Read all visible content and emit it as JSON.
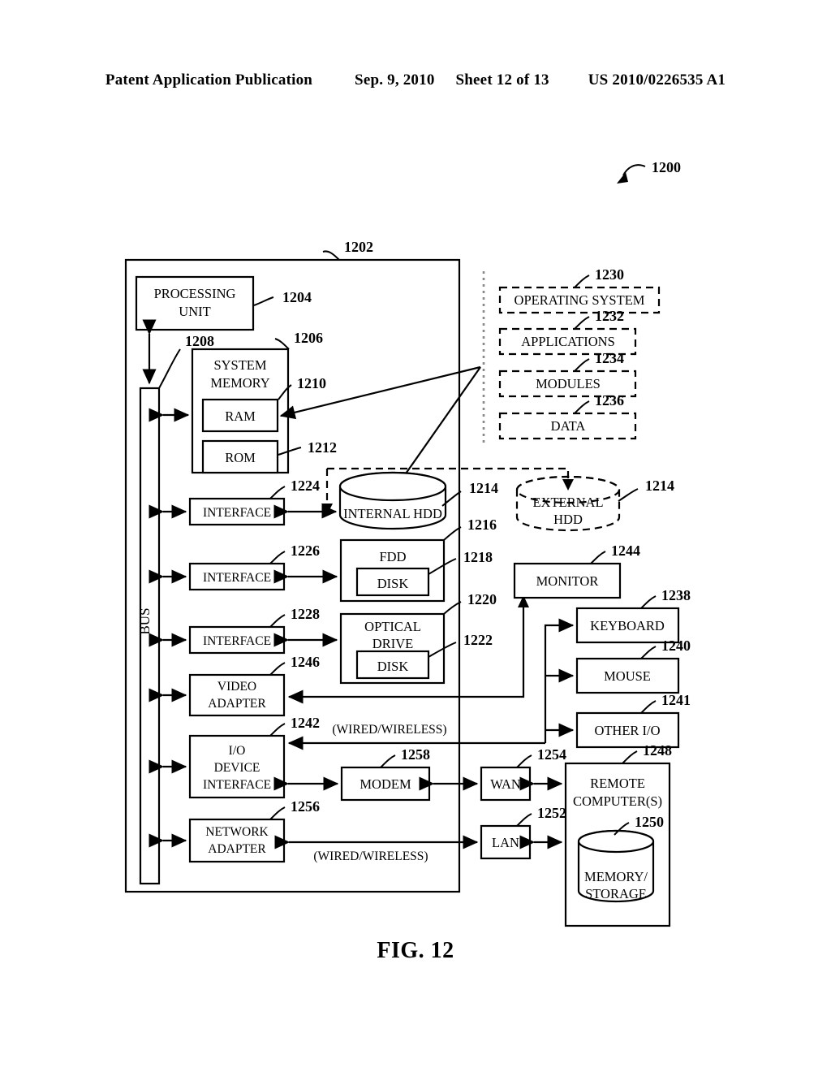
{
  "header": {
    "publication": "Patent Application Publication",
    "date": "Sep. 9, 2010",
    "sheet": "Sheet 12 of 13",
    "patent_number": "US 2010/0226535 A1"
  },
  "figure": {
    "caption": "FIG. 12",
    "system_ref": "1200"
  },
  "blocks": {
    "computer_boundary": {
      "ref": "1202"
    },
    "processing_unit": {
      "label_line1": "PROCESSING",
      "label_line2": "UNIT",
      "ref": "1204"
    },
    "system_memory": {
      "label_line1": "SYSTEM",
      "label_line2": "MEMORY",
      "ref": "1206"
    },
    "bus": {
      "label": "BUS",
      "ref": "1208"
    },
    "ram": {
      "label": "RAM",
      "ref": "1210"
    },
    "rom": {
      "label": "ROM",
      "ref": "1212"
    },
    "internal_hdd": {
      "label": "INTERNAL HDD",
      "ref": "1214"
    },
    "external_hdd": {
      "label_line1": "EXTERNAL",
      "label_line2": "HDD",
      "ref": "1214"
    },
    "fdd": {
      "label": "FDD",
      "ref": "1216"
    },
    "fdd_disk": {
      "label": "DISK",
      "ref": "1218"
    },
    "optical_drive": {
      "label_line1": "OPTICAL",
      "label_line2": "DRIVE",
      "ref": "1220"
    },
    "optical_disk": {
      "label": "DISK",
      "ref": "1222"
    },
    "interface_hdd": {
      "label": "INTERFACE",
      "ref": "1224"
    },
    "interface_fdd": {
      "label": "INTERFACE",
      "ref": "1226"
    },
    "interface_optical": {
      "label": "INTERFACE",
      "ref": "1228"
    },
    "operating_system": {
      "label": "OPERATING SYSTEM",
      "ref": "1230"
    },
    "applications": {
      "label": "APPLICATIONS",
      "ref": "1232"
    },
    "modules": {
      "label": "MODULES",
      "ref": "1234"
    },
    "data_store": {
      "label": "DATA",
      "ref": "1236"
    },
    "keyboard": {
      "label": "KEYBOARD",
      "ref": "1238"
    },
    "mouse": {
      "label": "MOUSE",
      "ref": "1240"
    },
    "other_io": {
      "label": "OTHER I/O",
      "ref": "1241"
    },
    "io_device_interface": {
      "label_line1": "I/O",
      "label_line2": "DEVICE",
      "label_line3": "INTERFACE",
      "ref": "1242"
    },
    "monitor": {
      "label": "MONITOR",
      "ref": "1244"
    },
    "video_adapter": {
      "label_line1": "VIDEO",
      "label_line2": "ADAPTER",
      "ref": "1246"
    },
    "remote_computers": {
      "label_line1": "REMOTE",
      "label_line2": "COMPUTER(S)",
      "ref": "1248"
    },
    "memory_storage": {
      "label_line1": "MEMORY/",
      "label_line2": "STORAGE",
      "ref": "1250"
    },
    "lan": {
      "label": "LAN",
      "ref": "1252"
    },
    "wan": {
      "label": "WAN",
      "ref": "1254"
    },
    "network_adapter": {
      "label_line1": "NETWORK",
      "label_line2": "ADAPTER",
      "ref": "1256"
    },
    "modem": {
      "label": "MODEM",
      "ref": "1258"
    }
  },
  "annotations": {
    "wired_wireless_top": "(WIRED/WIRELESS)",
    "wired_wireless_bottom": "(WIRED/WIRELESS)"
  },
  "colors": {
    "ink": "#000000",
    "paper": "#ffffff",
    "dotted_guide": "#888888"
  }
}
